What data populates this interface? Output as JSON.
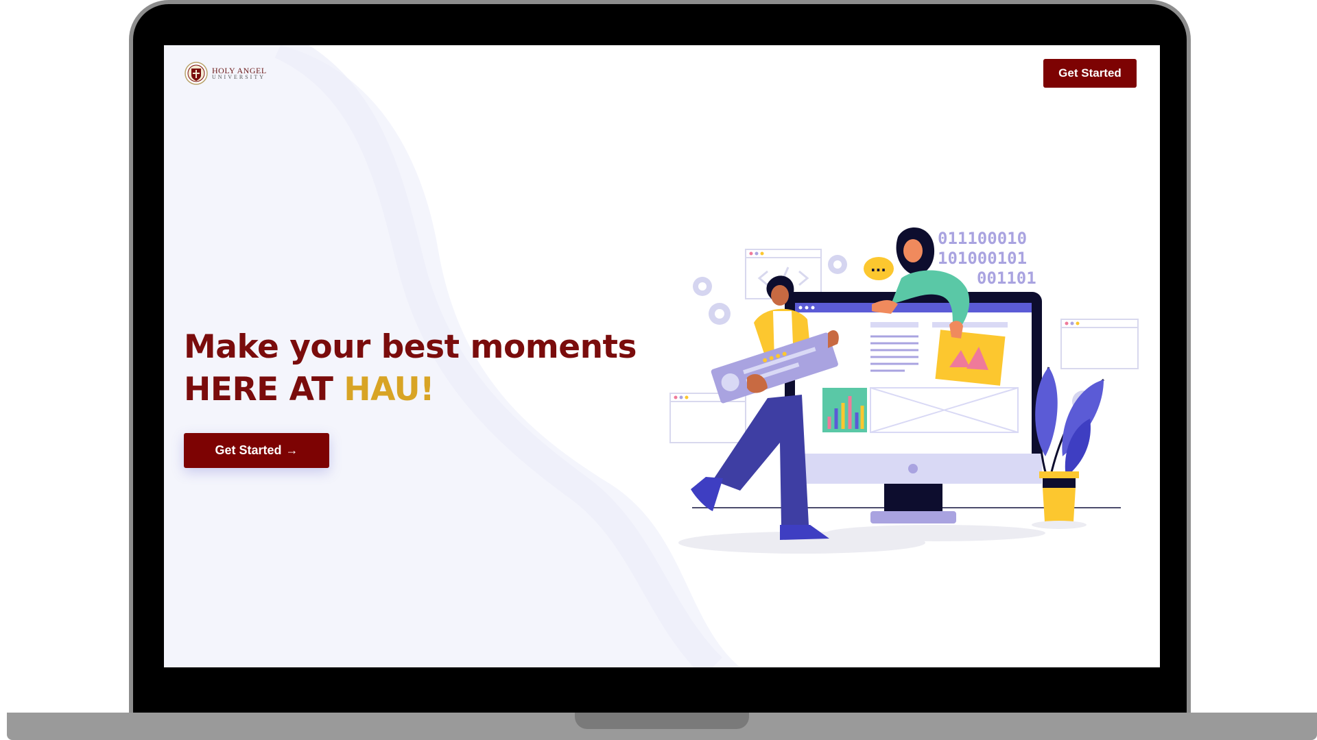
{
  "header": {
    "logo_line1": "HOLY ANGEL",
    "logo_line2": "UNIVERSITY",
    "get_started_label": "Get Started"
  },
  "hero": {
    "headline_line1": "Make your best moments",
    "headline_line2_prefix": "HERE AT ",
    "headline_line2_accent": "HAU!",
    "cta_label": "Get Started",
    "cta_arrow": "→"
  },
  "illustration": {
    "binary_lines": [
      "011100010",
      "101000101",
      "001101"
    ],
    "speech_bubble": "..."
  },
  "colors": {
    "brand_maroon": "#7d0303",
    "accent_gold": "#d8a425",
    "illustration_purple": "#5b5bd6",
    "illustration_yellow": "#fcc72f"
  },
  "icons": [
    "university-seal-icon",
    "arrow-right-icon",
    "gear-icon"
  ]
}
